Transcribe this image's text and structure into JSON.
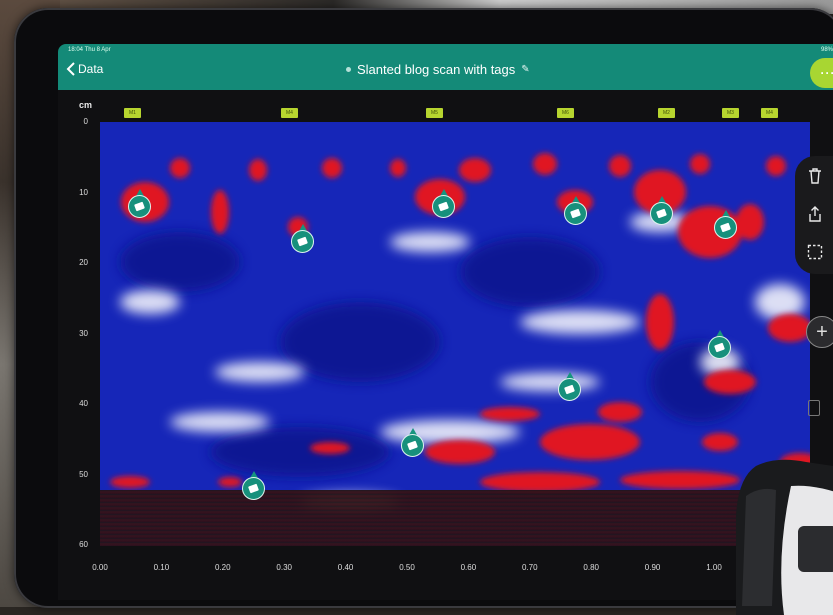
{
  "status_bar": {
    "left": "18:04 Thu 8 Apr",
    "right": "98%"
  },
  "header": {
    "back_label": "Data",
    "title": "Slanted blog scan with tags",
    "more_label": "···"
  },
  "y_axis": {
    "unit": "cm",
    "ticks": [
      "0",
      "10",
      "20",
      "30",
      "40",
      "50",
      "60"
    ]
  },
  "x_axis": {
    "ticks": [
      "0.00",
      "0.10",
      "0.20",
      "0.30",
      "0.40",
      "0.50",
      "0.60",
      "0.70",
      "0.80",
      "0.90",
      "1.00"
    ]
  },
  "marker_labels": [
    "M1",
    "M4",
    "M5",
    "M6",
    "M2",
    "M3",
    "M4"
  ],
  "colors": {
    "appbar": "#148a78",
    "accent": "#a8d632",
    "tag_pin": "#17907c",
    "radar_low": "#1624b8",
    "radar_high": "#e01420"
  },
  "toolbar": {
    "icons": [
      "trash-icon",
      "share-icon",
      "selection-icon"
    ]
  },
  "zoom_label": "+",
  "tag_pins": [
    {
      "x": 0.065,
      "depth_cm": 12
    },
    {
      "x": 0.33,
      "depth_cm": 17
    },
    {
      "x": 0.56,
      "depth_cm": 12
    },
    {
      "x": 0.775,
      "depth_cm": 13
    },
    {
      "x": 0.915,
      "depth_cm": 13
    },
    {
      "x": 1.02,
      "depth_cm": 15
    },
    {
      "x": 0.33,
      "depth_cm": 16
    },
    {
      "x": 1.01,
      "depth_cm": 32
    },
    {
      "x": 0.765,
      "depth_cm": 38
    },
    {
      "x": 0.51,
      "depth_cm": 46
    },
    {
      "x": 0.25,
      "depth_cm": 52
    }
  ]
}
